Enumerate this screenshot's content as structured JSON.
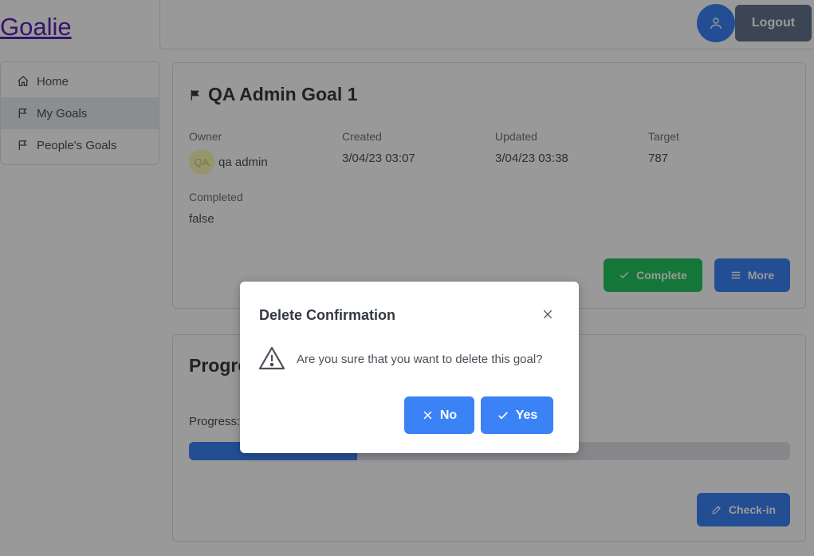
{
  "app": {
    "brand": "Goalie"
  },
  "header": {
    "logout_label": "Logout",
    "avatar_icon": "user-icon"
  },
  "sidebar": {
    "items": [
      {
        "label": "Home",
        "icon": "home-icon"
      },
      {
        "label": "My Goals",
        "icon": "flag-icon",
        "active": true
      },
      {
        "label": "People's Goals",
        "icon": "flag-icon"
      }
    ]
  },
  "goal": {
    "title": "QA Admin Goal 1",
    "owner_label": "Owner",
    "owner_initials": "QA",
    "owner_name": "qa admin",
    "created_label": "Created",
    "created_value": "3/04/23 03:07",
    "updated_label": "Updated",
    "updated_value": "3/04/23 03:38",
    "target_label": "Target",
    "target_value": "787",
    "completed_label": "Completed",
    "completed_value": "false",
    "complete_button": "Complete",
    "more_button": "More"
  },
  "progress": {
    "title": "Progress",
    "label": "Progress:",
    "percent": 28,
    "checkin_button": "Check-in"
  },
  "dialog": {
    "title": "Delete Confirmation",
    "message": "Are you sure that you want to delete this goal?",
    "no_label": "No",
    "yes_label": "Yes"
  },
  "colors": {
    "primary": "#3b82f6",
    "success": "#22c55e",
    "secondary": "#64748b"
  }
}
